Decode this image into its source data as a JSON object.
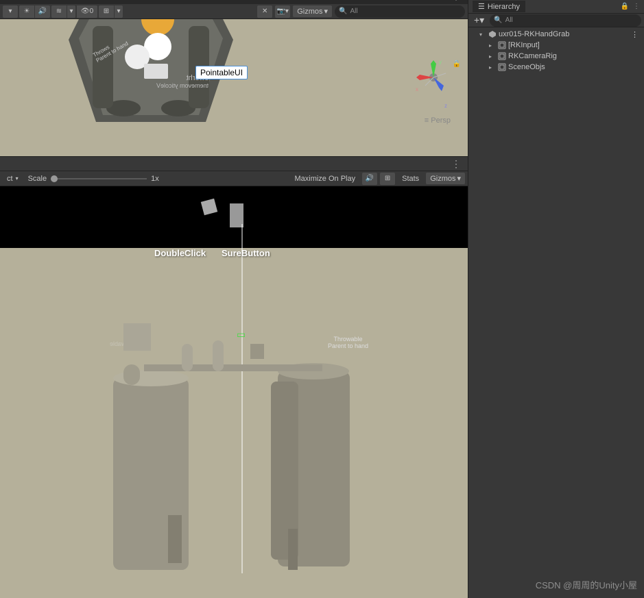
{
  "scene_toolbar": {
    "gizmos_label": "Gizmos",
    "search_placeholder": "All",
    "light_count": "0"
  },
  "scene_view": {
    "label_pointable": "PointableUI",
    "persp_label": "Persp",
    "axis_x": "x",
    "axis_y": "y",
    "axis_z": "z",
    "text_throws": "Throws",
    "text_parent": "Parent to hand",
    "text_mirror1": "sworht",
    "text_mirror2": "tnemevom yticoleV"
  },
  "game_toolbar": {
    "aspect_label": "ct",
    "scale_label": "Scale",
    "scale_value": "1x",
    "maximize_label": "Maximize On Play",
    "stats_label": "Stats",
    "gizmos_label": "Gizmos"
  },
  "game_view": {
    "label_doubleclick": "DoubleClick",
    "label_surebutton": "SureButton",
    "label_throwable": "Throwable",
    "label_parent": "Parent to hand"
  },
  "hierarchy": {
    "title": "Hierarchy",
    "search_placeholder": "All",
    "scene_name": "uxr015-RKHandGrab",
    "items": [
      {
        "label": "[RKInput]",
        "has_children": true
      },
      {
        "label": "RKCameraRig",
        "has_children": true
      },
      {
        "label": "SceneObjs",
        "has_children": true
      }
    ]
  },
  "watermark": "CSDN @周周的Unity小屋"
}
